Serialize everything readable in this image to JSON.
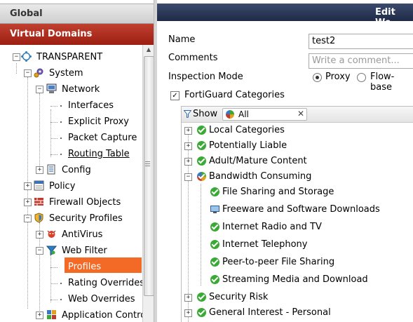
{
  "left": {
    "global_label": "Global",
    "vdom_label": "Virtual Domains",
    "tree": [
      {
        "label": "TRANSPARENT",
        "icon": "vdom-globe-icon"
      },
      {
        "label": "System",
        "icon": "system-gear-icon"
      },
      {
        "label": "Network",
        "icon": "network-icon"
      },
      {
        "label": "Interfaces"
      },
      {
        "label": "Explicit Proxy"
      },
      {
        "label": "Packet Capture"
      },
      {
        "label": "Routing Table"
      },
      {
        "label": "Config",
        "icon": "config-icon"
      },
      {
        "label": "Policy",
        "icon": "policy-icon"
      },
      {
        "label": "Firewall Objects",
        "icon": "firewall-objects-icon"
      },
      {
        "label": "Security Profiles",
        "icon": "security-profiles-icon"
      },
      {
        "label": "AntiVirus",
        "icon": "antivirus-icon"
      },
      {
        "label": "Web Filter",
        "icon": "web-filter-icon"
      },
      {
        "label": "Profiles",
        "selected": true
      },
      {
        "label": "Rating Overrides"
      },
      {
        "label": "Web Overrides"
      },
      {
        "label": "Application Contro",
        "icon": "application-control-icon"
      }
    ]
  },
  "right": {
    "title": "Edit We",
    "name_label": "Name",
    "name_value": "test2",
    "comments_label": "Comments",
    "comments_placeholder": "Write a comment...",
    "inspection_label": "Inspection Mode",
    "inspection_options": [
      "Proxy",
      "Flow-base"
    ],
    "inspection_selected": "Proxy",
    "fortiguard_label": "FortiGuard Categories",
    "fortiguard_checked": true,
    "show_label": "Show",
    "filter_value": "All",
    "categories": [
      {
        "label": "Local Categories",
        "level": 0,
        "expander": "+",
        "icon": "allow-check-icon"
      },
      {
        "label": "Potentially Liable",
        "level": 0,
        "expander": "+",
        "icon": "allow-check-icon"
      },
      {
        "label": "Adult/Mature Content",
        "level": 0,
        "expander": "+",
        "icon": "allow-check-icon"
      },
      {
        "label": "Bandwidth Consuming",
        "level": 0,
        "expander": "-",
        "icon": "mixed-action-icon"
      },
      {
        "label": "File Sharing and Storage",
        "level": 1,
        "icon": "allow-check-icon"
      },
      {
        "label": "Freeware and Software Downloads",
        "level": 1,
        "icon": "monitor-icon"
      },
      {
        "label": "Internet Radio and TV",
        "level": 1,
        "icon": "allow-check-icon"
      },
      {
        "label": "Internet Telephony",
        "level": 1,
        "icon": "allow-check-icon"
      },
      {
        "label": "Peer-to-peer File Sharing",
        "level": 1,
        "icon": "allow-check-icon"
      },
      {
        "label": "Streaming Media and Download",
        "level": 1,
        "icon": "allow-check-icon"
      },
      {
        "label": "Security Risk",
        "level": 0,
        "expander": "+",
        "icon": "allow-check-icon"
      },
      {
        "label": "General Interest - Personal",
        "level": 0,
        "expander": "+",
        "icon": "allow-check-icon"
      }
    ]
  }
}
